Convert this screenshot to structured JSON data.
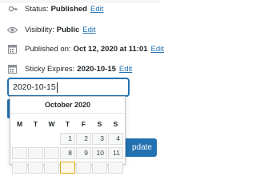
{
  "status": {
    "label": "Status:",
    "value": "Published",
    "edit": "Edit",
    "icon": "key-icon"
  },
  "visibility": {
    "label": "Visibility:",
    "value": "Public",
    "edit": "Edit",
    "icon": "eye-icon"
  },
  "published": {
    "label": "Published on:",
    "value": "Oct 12, 2020 at 11:01",
    "edit": "Edit",
    "icon": "calendar-icon"
  },
  "sticky": {
    "label": "Sticky Expires:",
    "value": "2020-10-15",
    "edit": "Edit",
    "icon": "calendar-icon"
  },
  "date_input": {
    "value": "2020-10-15"
  },
  "calendar": {
    "month_title": "October 2020",
    "weekdays": [
      "M",
      "T",
      "W",
      "T",
      "F",
      "S",
      "S"
    ],
    "visible_days": [
      "1",
      "2",
      "3",
      "4",
      "8",
      "9",
      "10",
      "11"
    ]
  },
  "update_button": {
    "label": "pdate"
  },
  "colors": {
    "accent": "#2271b1",
    "text": "#1d2327",
    "calendar_border": "#c3c4c7",
    "highlight": "#dba617"
  }
}
